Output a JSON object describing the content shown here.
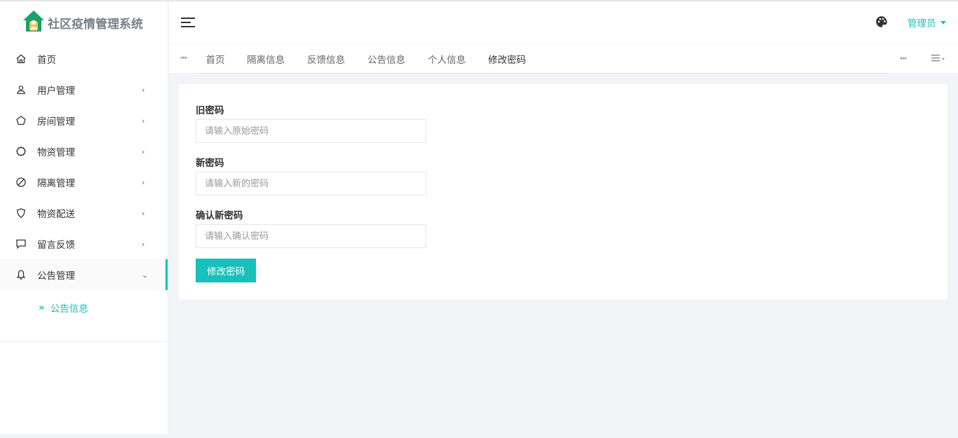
{
  "app": {
    "title": "社区疫情管理系统",
    "accent_color": "#17c1b9",
    "logo_icon": "house-person-logo"
  },
  "sidebar": {
    "items": [
      {
        "label": "首页",
        "icon": "home-icon",
        "has_children": false
      },
      {
        "label": "用户管理",
        "icon": "user-icon",
        "has_children": true
      },
      {
        "label": "房间管理",
        "icon": "pentagon-icon",
        "has_children": true
      },
      {
        "label": "物资管理",
        "icon": "gear-icon",
        "has_children": true
      },
      {
        "label": "隔离管理",
        "icon": "ban-icon",
        "has_children": true
      },
      {
        "label": "物资配送",
        "icon": "shield-icon",
        "has_children": true
      },
      {
        "label": "留言反馈",
        "icon": "message-icon",
        "has_children": true
      },
      {
        "label": "公告管理",
        "icon": "bell-icon",
        "has_children": true,
        "expanded": true
      }
    ],
    "submenu": [
      {
        "label": "公告信息",
        "prefix": "»"
      }
    ]
  },
  "header": {
    "user_label": "管理员",
    "theme_icon": "palette-icon"
  },
  "tabs": {
    "items": [
      {
        "label": "首页"
      },
      {
        "label": "隔离信息"
      },
      {
        "label": "反馈信息"
      },
      {
        "label": "公告信息"
      },
      {
        "label": "个人信息"
      },
      {
        "label": "修改密码",
        "active": true
      }
    ],
    "prev_glyph": "⏮",
    "next_glyph": "⏭"
  },
  "form": {
    "old_password": {
      "label": "旧密码",
      "placeholder": "请输入原始密码",
      "value": ""
    },
    "new_password": {
      "label": "新密码",
      "placeholder": "请输入新的密码",
      "value": ""
    },
    "confirm_password": {
      "label": "确认新密码",
      "placeholder": "请输入确认密码",
      "value": ""
    },
    "submit_label": "修改密码"
  }
}
